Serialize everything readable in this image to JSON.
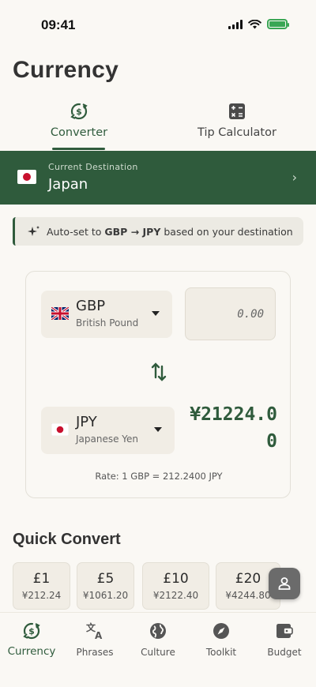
{
  "status_bar": {
    "time": "09:41"
  },
  "page": {
    "title": "Currency"
  },
  "tabs": [
    {
      "label": "Converter",
      "icon": "currency-exchange-icon",
      "active": true
    },
    {
      "label": "Tip Calculator",
      "icon": "calculator-icon",
      "active": false
    }
  ],
  "destination": {
    "caption": "Current Destination",
    "name": "Japan",
    "flag": "japan-flag"
  },
  "auto_note": {
    "prefix": "Auto-set to ",
    "pair": "GBP → JPY",
    "suffix": " based on your destination"
  },
  "converter": {
    "from": {
      "code": "GBP",
      "name": "British Pound",
      "flag": "uk-flag"
    },
    "to": {
      "code": "JPY",
      "name": "Japanese Yen",
      "flag": "japan-flag"
    },
    "amount_value": "",
    "amount_placeholder": "0.00",
    "result": "¥21224.00",
    "rate": "Rate: 1 GBP = 212.2400 JPY"
  },
  "quick_convert": {
    "title": "Quick Convert",
    "items": [
      {
        "gbp": "£1",
        "jpy": "¥212.24"
      },
      {
        "gbp": "£5",
        "jpy": "¥1061.20"
      },
      {
        "gbp": "£10",
        "jpy": "¥2122.40"
      },
      {
        "gbp": "£20",
        "jpy": "¥4244.80"
      }
    ]
  },
  "nav": [
    {
      "label": "Currency",
      "icon": "currency-exchange-icon",
      "active": true
    },
    {
      "label": "Phrases",
      "icon": "translate-icon",
      "active": false
    },
    {
      "label": "Culture",
      "icon": "globe-icon",
      "active": false
    },
    {
      "label": "Toolkit",
      "icon": "compass-icon",
      "active": false
    },
    {
      "label": "Budget",
      "icon": "wallet-icon",
      "active": false
    }
  ],
  "colors": {
    "primary": "#2f5b3c",
    "background": "#faf8f4",
    "surface": "#f1ede5",
    "battery": "#3aa655"
  }
}
